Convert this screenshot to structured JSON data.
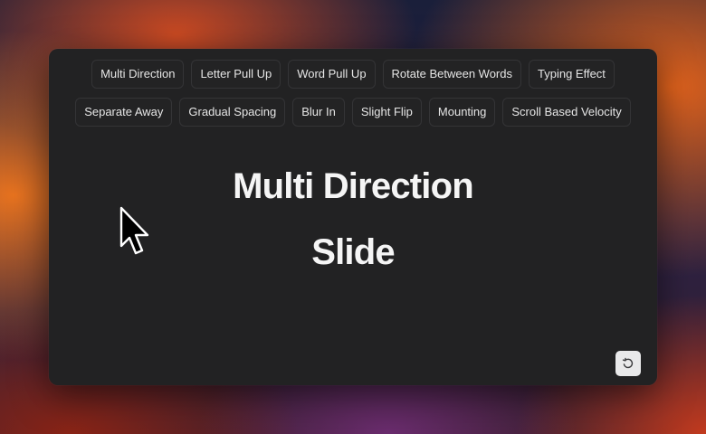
{
  "tabs_row1": [
    {
      "label": "Multi Direction"
    },
    {
      "label": "Letter Pull Up"
    },
    {
      "label": "Word Pull Up"
    },
    {
      "label": "Rotate Between Words"
    },
    {
      "label": "Typing Effect"
    }
  ],
  "tabs_row2": [
    {
      "label": "Separate Away"
    },
    {
      "label": "Gradual Spacing"
    },
    {
      "label": "Blur In"
    },
    {
      "label": "Slight Flip"
    },
    {
      "label": "Mounting"
    },
    {
      "label": "Scroll Based Velocity"
    }
  ],
  "preview": {
    "line1": "Multi Direction",
    "line2": "Slide"
  },
  "icons": {
    "reset": "refresh-icon",
    "cursor": "mouse-pointer-icon"
  },
  "colors": {
    "panel_bg": "#222223",
    "tab_border": "#343436",
    "text": "#f5f5f5",
    "reset_button_bg": "#e9e9ea"
  }
}
